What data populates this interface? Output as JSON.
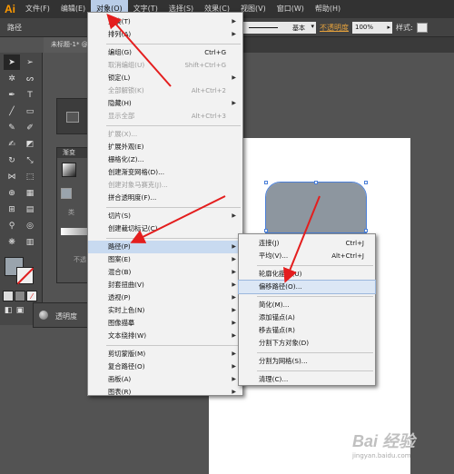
{
  "menubar": {
    "logo": "Ai",
    "items": [
      "文件(F)",
      "编辑(E)",
      "对象(O)",
      "文字(T)",
      "选择(S)",
      "效果(C)",
      "视图(V)",
      "窗口(W)",
      "帮助(H)"
    ]
  },
  "controlbar": {
    "path_label": "路径",
    "stroke_style": "基本",
    "opacity_link": "不透明度",
    "opacity_value": "100%",
    "style_label": "样式:"
  },
  "doc_tab": "未标题-1* @",
  "panels": {
    "gradient_tab": "渐变",
    "gradient_type_label": "类",
    "gradient_opacity_label": "不透",
    "transparency_label": "透明度"
  },
  "object_menu": {
    "items": [
      {
        "label": "变换(T)",
        "shortcut": "",
        "submenu": true,
        "disabled": false
      },
      {
        "label": "排列(A)",
        "shortcut": "",
        "submenu": true,
        "disabled": false
      },
      {
        "label": "编组(G)",
        "shortcut": "Ctrl+G",
        "submenu": false,
        "disabled": false
      },
      {
        "label": "取消编组(U)",
        "shortcut": "Shift+Ctrl+G",
        "submenu": false,
        "disabled": true
      },
      {
        "label": "锁定(L)",
        "shortcut": "",
        "submenu": true,
        "disabled": false
      },
      {
        "label": "全部解锁(K)",
        "shortcut": "Alt+Ctrl+2",
        "submenu": false,
        "disabled": true
      },
      {
        "label": "隐藏(H)",
        "shortcut": "",
        "submenu": true,
        "disabled": false
      },
      {
        "label": "显示全部",
        "shortcut": "Alt+Ctrl+3",
        "submenu": false,
        "disabled": true
      },
      {
        "label": "扩展(X)...",
        "shortcut": "",
        "submenu": false,
        "disabled": true
      },
      {
        "label": "扩展外观(E)",
        "shortcut": "",
        "submenu": false,
        "disabled": false
      },
      {
        "label": "栅格化(Z)...",
        "shortcut": "",
        "submenu": false,
        "disabled": false
      },
      {
        "label": "创建渐变网格(D)...",
        "shortcut": "",
        "submenu": false,
        "disabled": false
      },
      {
        "label": "创建对象马赛克(J)...",
        "shortcut": "",
        "submenu": false,
        "disabled": true
      },
      {
        "label": "拼合透明度(F)...",
        "shortcut": "",
        "submenu": false,
        "disabled": false
      },
      {
        "label": "切片(S)",
        "shortcut": "",
        "submenu": true,
        "disabled": false
      },
      {
        "label": "创建裁切标记(C)",
        "shortcut": "",
        "submenu": false,
        "disabled": false
      },
      {
        "label": "路径(P)",
        "shortcut": "",
        "submenu": true,
        "disabled": false
      },
      {
        "label": "图案(E)",
        "shortcut": "",
        "submenu": true,
        "disabled": false
      },
      {
        "label": "混合(B)",
        "shortcut": "",
        "submenu": true,
        "disabled": false
      },
      {
        "label": "封套扭曲(V)",
        "shortcut": "",
        "submenu": true,
        "disabled": false
      },
      {
        "label": "透视(P)",
        "shortcut": "",
        "submenu": true,
        "disabled": false
      },
      {
        "label": "实时上色(N)",
        "shortcut": "",
        "submenu": true,
        "disabled": false
      },
      {
        "label": "图像描摹",
        "shortcut": "",
        "submenu": true,
        "disabled": false
      },
      {
        "label": "文本绕排(W)",
        "shortcut": "",
        "submenu": true,
        "disabled": false
      },
      {
        "label": "剪切蒙版(M)",
        "shortcut": "",
        "submenu": true,
        "disabled": false
      },
      {
        "label": "复合路径(O)",
        "shortcut": "",
        "submenu": true,
        "disabled": false
      },
      {
        "label": "画板(A)",
        "shortcut": "",
        "submenu": true,
        "disabled": false
      },
      {
        "label": "图表(R)",
        "shortcut": "",
        "submenu": true,
        "disabled": false
      }
    ]
  },
  "path_submenu": {
    "items": [
      {
        "label": "连接(J)",
        "shortcut": "Ctrl+J"
      },
      {
        "label": "平均(V)...",
        "shortcut": "Alt+Ctrl+J"
      },
      {
        "label": "轮廓化描边(U)",
        "shortcut": ""
      },
      {
        "label": "偏移路径(O)...",
        "shortcut": ""
      },
      {
        "label": "简化(M)...",
        "shortcut": ""
      },
      {
        "label": "添加锚点(A)",
        "shortcut": ""
      },
      {
        "label": "移去锚点(R)",
        "shortcut": ""
      },
      {
        "label": "分割下方对象(D)",
        "shortcut": ""
      },
      {
        "label": "分割为网格(S)...",
        "shortcut": ""
      },
      {
        "label": "清理(C)...",
        "shortcut": ""
      }
    ]
  },
  "colors": {
    "active_menu": "#b9cde8",
    "annotation_arrow": "#e41e1e",
    "shape_fill": "#8d969f",
    "selection": "#4a7fd8"
  },
  "watermark": {
    "main": "Bai 经验",
    "sub": "jingyan.baidu.com"
  }
}
